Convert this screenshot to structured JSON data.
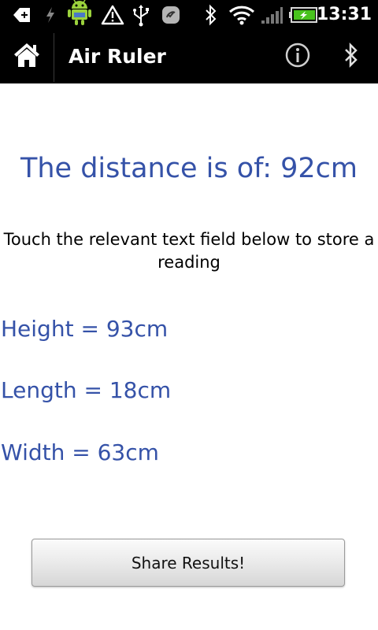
{
  "status_bar": {
    "time": "13:31",
    "icons": [
      "plus-notification-icon",
      "usb-charging-icon",
      "android-robot-icon",
      "warning-icon",
      "usb-icon",
      "app-notification-icon",
      "bluetooth-icon",
      "wifi-icon",
      "signal-icon",
      "battery-icon"
    ],
    "battery_color": "#48c31d"
  },
  "action_bar": {
    "title": "Air Ruler",
    "home_icon": "home-icon",
    "info_icon": "info-icon",
    "bluetooth_icon": "bluetooth-icon"
  },
  "main": {
    "distance_text": "The distance is of: 92cm",
    "instruction_text": "Touch the relevant text field below to store a reading",
    "readings": [
      {
        "label": "Height = 93cm"
      },
      {
        "label": "Length = 18cm"
      },
      {
        "label": "Width = 63cm"
      }
    ],
    "share_button_label": "Share Results!"
  },
  "colors": {
    "accent_blue": "#3552a8",
    "bar_background": "#000000"
  }
}
